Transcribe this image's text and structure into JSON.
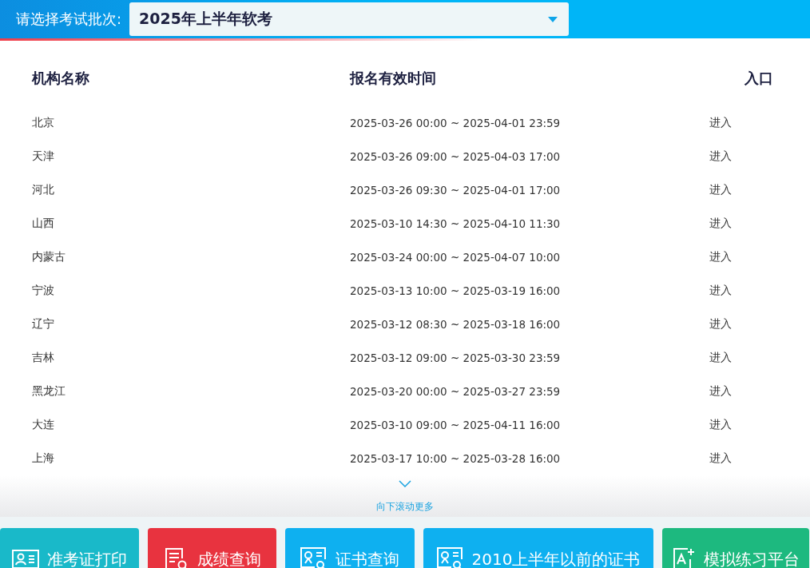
{
  "header": {
    "label": "请选择考试批次:",
    "select": {
      "value": "2025年上半年软考"
    }
  },
  "table": {
    "columns": [
      "机构名称",
      "报名有效时间",
      "入口"
    ],
    "rows": [
      {
        "name": "北京",
        "time": "2025-03-26 00:00 ~ 2025-04-01 23:59",
        "entry": "进入"
      },
      {
        "name": "天津",
        "time": "2025-03-26 09:00 ~ 2025-04-03 17:00",
        "entry": "进入"
      },
      {
        "name": "河北",
        "time": "2025-03-26 09:30 ~ 2025-04-01 17:00",
        "entry": "进入"
      },
      {
        "name": "山西",
        "time": "2025-03-10 14:30 ~ 2025-04-10 11:30",
        "entry": "进入"
      },
      {
        "name": "内蒙古",
        "time": "2025-03-24 00:00 ~ 2025-04-07 10:00",
        "entry": "进入"
      },
      {
        "name": "宁波",
        "time": "2025-03-13 10:00 ~ 2025-03-19 16:00",
        "entry": "进入"
      },
      {
        "name": "辽宁",
        "time": "2025-03-12 08:30 ~ 2025-03-18 16:00",
        "entry": "进入"
      },
      {
        "name": "吉林",
        "time": "2025-03-12 09:00 ~ 2025-03-30 23:59",
        "entry": "进入"
      },
      {
        "name": "黑龙江",
        "time": "2025-03-20 00:00 ~ 2025-03-27 23:59",
        "entry": "进入"
      },
      {
        "name": "大连",
        "time": "2025-03-10 09:00 ~ 2025-04-11 16:00",
        "entry": "进入"
      },
      {
        "name": "上海",
        "time": "2025-03-17 10:00 ~ 2025-03-28 16:00",
        "entry": "进入"
      }
    ]
  },
  "scroll_hint": "向下滚动更多",
  "actions": [
    {
      "label": "准考证打印",
      "kind": "card",
      "color": "#19b9c9"
    },
    {
      "label": "成绩查询",
      "kind": "report",
      "color": "#e8333f"
    },
    {
      "label": "证书查询",
      "kind": "cert",
      "color": "#0eb0f0"
    },
    {
      "label": "2010上半年以前的证书",
      "kind": "cert",
      "color": "#0eb0f0"
    },
    {
      "label": "模拟练习平台",
      "kind": "edit",
      "color": "#1db97f"
    }
  ]
}
